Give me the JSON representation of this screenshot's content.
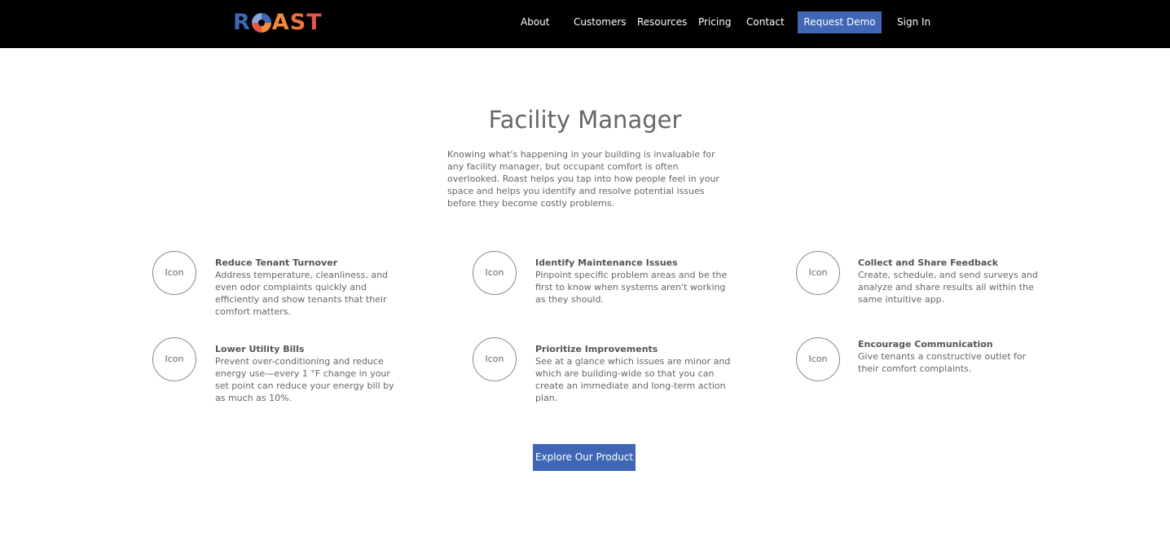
{
  "brand": {
    "logo_letters": [
      "R",
      "O",
      "A",
      "S",
      "T"
    ],
    "logo_text": "ROAST"
  },
  "nav": {
    "links": [
      {
        "label": "About"
      },
      {
        "label": "Customers"
      },
      {
        "label": "Resources"
      },
      {
        "label": "Pricing"
      },
      {
        "label": "Contact"
      }
    ],
    "request_demo": "Request Demo",
    "sign_in": "Sign In"
  },
  "hero": {
    "title": "Facility Manager",
    "intro": "Knowing what's happening in your building is invaluable for any facility manager, but occupant comfort is often overlooked. Roast helps you tap into how people feel in your space and helps you identify and resolve potential issues before they become costly problems."
  },
  "features": [
    {
      "icon_label": "Icon",
      "title": "Reduce Tenant Turnover",
      "text": "Address temperature, cleanliness, and even odor complaints quickly and efficiently and show tenants that their comfort matters."
    },
    {
      "icon_label": "Icon",
      "title": "Identify Maintenance Issues",
      "text": "Pinpoint specific problem areas and be the first to know when systems aren't working as they should."
    },
    {
      "icon_label": "Icon",
      "title": "Collect and Share Feedback",
      "text": "Create, schedule, and send surveys and analyze and share results all within the same intuitive app."
    },
    {
      "icon_label": "Icon",
      "title": "Lower Utility Bills",
      "text": "Prevent over-conditioning and reduce energy use—every 1 °F change in your set point can reduce your energy bill by as much as 10%."
    },
    {
      "icon_label": "Icon",
      "title": "Prioritize Improvements",
      "text": "See at a glance which issues are minor and which are building-wide so that you can create an immediate and long-term action plan."
    },
    {
      "icon_label": "Icon",
      "title": "Encourage Communication",
      "text": "Give tenants a constructive outlet for their comfort complaints."
    }
  ],
  "cta": {
    "label": "Explore Our Product"
  },
  "colors": {
    "nav_background": "#000000",
    "accent": "#3f67b5",
    "text": "#666666"
  }
}
